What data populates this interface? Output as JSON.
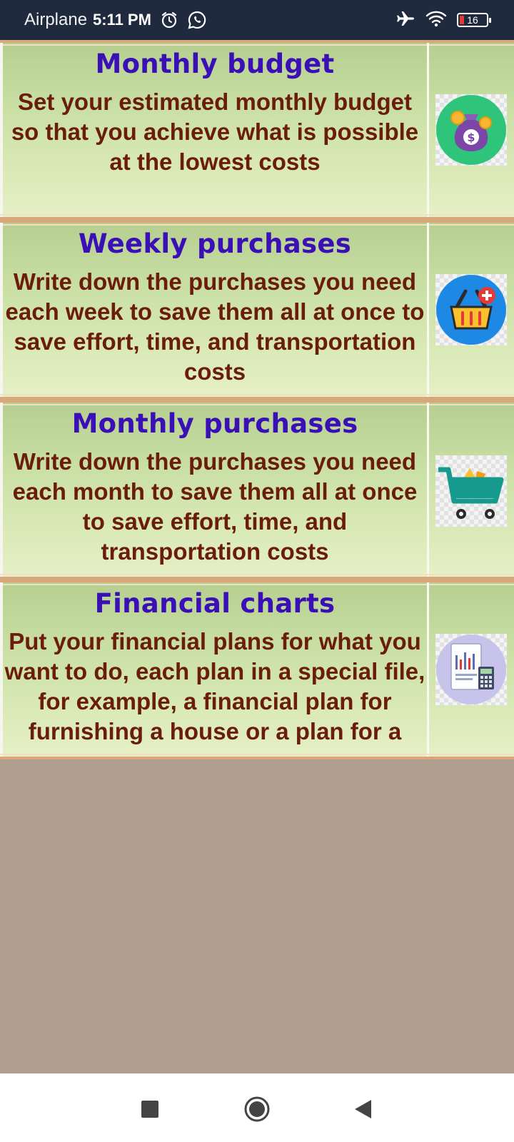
{
  "status_bar": {
    "carrier": "Airplane",
    "time": "5:11 PM",
    "icons": [
      "alarm-icon",
      "whatsapp-icon",
      "airplane-icon",
      "wifi-icon"
    ],
    "battery_level": "16"
  },
  "cards": [
    {
      "title": "Monthly budget",
      "description": "Set your estimated monthly budget so that you achieve what is possible at the lowest costs",
      "icon": "money-bag-icon"
    },
    {
      "title": "Weekly purchases",
      "description": "Write down the purchases you need each week to save them all at once to save effort, time, and transportation costs",
      "icon": "basket-icon"
    },
    {
      "title": "Monthly purchases",
      "description": "Write down the purchases you need each month to save them all at once to save effort, time, and transportation costs",
      "icon": "shopping-cart-icon"
    },
    {
      "title": "Financial charts",
      "description": "Put your financial plans for what you want to do, each plan in a special file, for example, a financial plan for furnishing a house or a plan for a",
      "icon": "financial-chart-icon"
    }
  ],
  "navigation": {
    "icons": [
      "recents-icon",
      "home-icon",
      "back-icon"
    ]
  },
  "colors": {
    "status_bar_bg": "#1f2a3f",
    "title_color": "#3a10b6",
    "text_color": "#6b1d0c",
    "page_bg": "#b09e8e"
  }
}
